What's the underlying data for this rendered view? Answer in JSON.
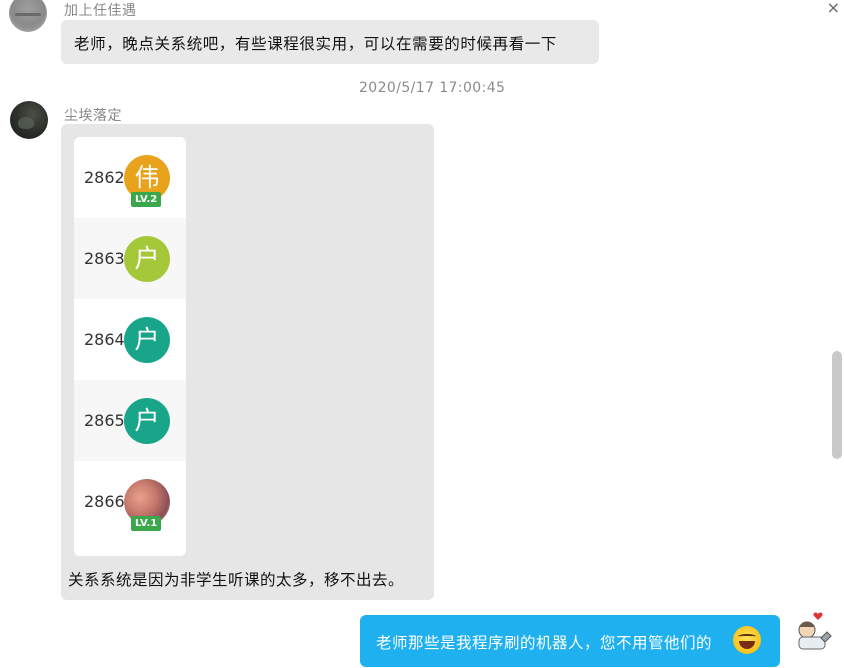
{
  "messages": [
    {
      "sender": "加上任佳遇",
      "text": "老师，晚点关系统吧，有些课程很实用，可以在需要的时候再看一下"
    },
    {
      "timestamp": "2020/5/17 17:00:45",
      "sender": "尘埃落定",
      "list": [
        {
          "number": "2862",
          "avatar_char": "伟",
          "avatar_color": "#e8a21c",
          "level": "LV.2"
        },
        {
          "number": "2863",
          "avatar_char": "户",
          "avatar_color": "#a5c83a",
          "level": ""
        },
        {
          "number": "2864",
          "avatar_char": "户",
          "avatar_color": "#18a58a",
          "level": ""
        },
        {
          "number": "2865",
          "avatar_char": "户",
          "avatar_color": "#18a58a",
          "level": ""
        },
        {
          "number": "2866",
          "avatar_char": "",
          "avatar_color": "photo",
          "level": "LV.1"
        }
      ],
      "caption": "关系系统是因为非学生听课的太多，移不出去。"
    },
    {
      "text": "老师那些是我程序刷的机器人，您不用管他们的",
      "emoji": "laughing-emoji"
    }
  ],
  "window": {
    "close_glyph": "×"
  }
}
